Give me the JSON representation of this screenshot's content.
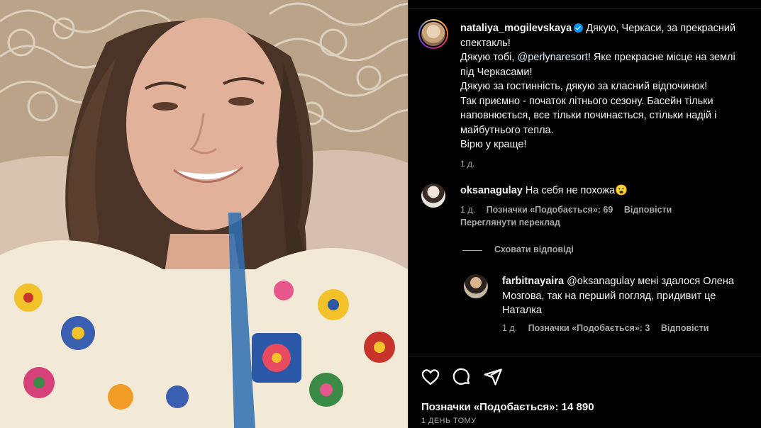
{
  "post": {
    "username": "nataliya_mogilevskaya",
    "caption_lines": [
      "Дякую, Черкаси, за прекрасний",
      "спектакль!",
      "Дякую тобі, ",
      "@perlynaresort",
      "! Яке прекрасне місце на землі",
      "під Черкасами!",
      "Дякую за гостинність, дякую за класний відпочинок!",
      "Так приємно - початок літнього сезону. Басейн тільки",
      "наповнюється, все тільки починається, стільки надій і",
      "майбутнього тепла.",
      "Вірю у краще!"
    ],
    "caption_time": "1 д."
  },
  "comments": [
    {
      "username": "oksanagulay",
      "text": "На себя не похожа😮",
      "time": "1 д.",
      "likes": "Позначки «Подобається»: 69",
      "reply_label": "Відповісти",
      "translate_label": "Переглянути переклад"
    }
  ],
  "hide_replies_label": "Сховати відповіді",
  "replies": [
    {
      "username": "farbitnayaira",
      "text_lines": [
        "@oksanagulay мені здалося Олена",
        "Мозгова, так на перший погляд, придивит це",
        "Наталка"
      ],
      "time": "1 д.",
      "likes": "Позначки «Подобається»: 3",
      "reply_label": "Відповісти"
    }
  ],
  "footer": {
    "likes": "Позначки «Подобається»: 14 890",
    "posted": "1 ДЕНЬ ТОМУ"
  },
  "icons": [
    "heart-icon",
    "comment-icon",
    "share-icon",
    "verified-badge-icon"
  ],
  "colors": {
    "background": "#000000",
    "text": "#f5f5f5",
    "muted": "#a8a8a8",
    "verified": "#0095f6"
  }
}
